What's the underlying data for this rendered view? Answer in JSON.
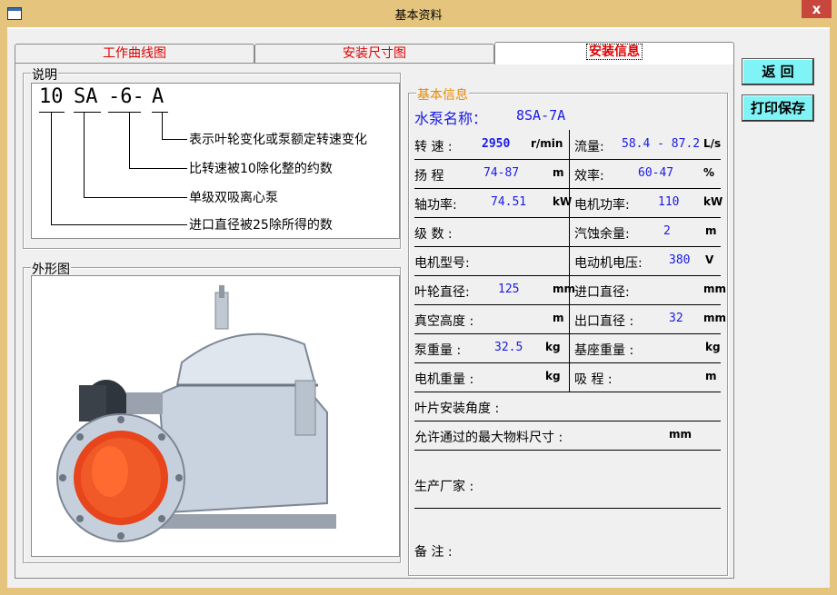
{
  "window": {
    "title": "基本资料",
    "close_glyph": "x"
  },
  "tabs": [
    {
      "label": "工作曲线图",
      "active": false
    },
    {
      "label": "安装尺寸图",
      "active": false
    },
    {
      "label": "安装信息",
      "active": true
    }
  ],
  "description": {
    "group_label": "说明",
    "model_parts": [
      "10",
      "SA",
      "-6-",
      "A"
    ],
    "annotations": [
      "表示叶轮变化或泵额定转速变化",
      "比转速被10除化整的约数",
      "单级双吸离心泵",
      "进口直径被25除所得的数"
    ]
  },
  "photo": {
    "group_label": "外形图"
  },
  "info": {
    "group_label": "基本信息",
    "pump_name_label": "水泵名称：",
    "pump_name": "8SA-7A",
    "rows": [
      {
        "left": {
          "label": "转 速 :",
          "value": "2950",
          "unit": "r/min"
        },
        "right": {
          "label": "流量:",
          "value": "58.4 - 87.2",
          "unit": "L/s"
        }
      },
      {
        "left": {
          "label": "扬 程",
          "value": "74-87",
          "unit": "m"
        },
        "right": {
          "label": "效率:",
          "value": "60-47",
          "unit": "%"
        }
      },
      {
        "left": {
          "label": "轴功率:",
          "value": "74.51",
          "unit": "kW"
        },
        "right": {
          "label": "电机功率:",
          "value": "110",
          "unit": "kW"
        }
      },
      {
        "left": {
          "label": "级 数 :",
          "value": "",
          "unit": ""
        },
        "right": {
          "label": "汽蚀余量:",
          "value": "2",
          "unit": "m"
        }
      },
      {
        "left": {
          "label": "电机型号:",
          "value": "",
          "unit": ""
        },
        "right": {
          "label": "电动机电压:",
          "value": "380",
          "unit": "V"
        }
      },
      {
        "left": {
          "label": "叶轮直径:",
          "value": "125",
          "unit": "mm"
        },
        "right": {
          "label": "进口直径:",
          "value": "",
          "unit": "mm"
        }
      },
      {
        "left": {
          "label": "真空高度 :",
          "value": "",
          "unit": "m"
        },
        "right": {
          "label": "出口直径 :",
          "value": "32",
          "unit": "mm"
        }
      },
      {
        "left": {
          "label": "泵重量 :",
          "value": "32.5",
          "unit": "kg"
        },
        "right": {
          "label": "基座重量 :",
          "value": "",
          "unit": "kg"
        }
      },
      {
        "left": {
          "label": "电机重量 :",
          "value": "",
          "unit": "kg"
        },
        "right": {
          "label": "吸 程 :",
          "value": "",
          "unit": "m"
        }
      }
    ],
    "blade_angle_label": "叶片安装角度 :",
    "max_particle_label": "允许通过的最大物料尺寸 :",
    "max_particle_unit": "mm",
    "manufacturer_label": "生产厂家 :",
    "remarks_label": "备 注 :"
  },
  "buttons": {
    "back": "返 回",
    "print_save": "打印保存"
  }
}
